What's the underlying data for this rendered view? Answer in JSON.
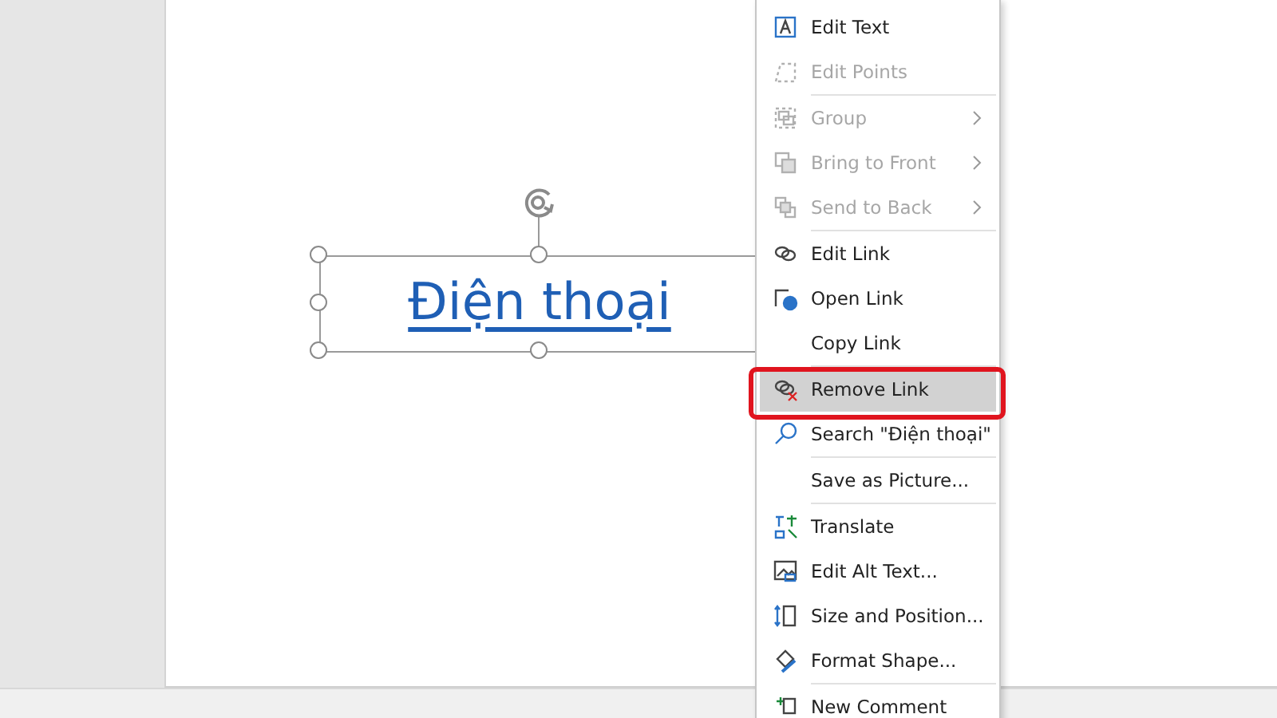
{
  "slide": {
    "text_box": {
      "text": "Điện thoại",
      "selected": true
    }
  },
  "context_menu": {
    "items": [
      {
        "label": "Edit Text",
        "disabled": false,
        "selected": false,
        "submenu": false,
        "separator_after": false
      },
      {
        "label": "Edit Points",
        "disabled": true,
        "selected": false,
        "submenu": false,
        "separator_after": true
      },
      {
        "label": "Group",
        "disabled": true,
        "selected": false,
        "submenu": true,
        "separator_after": false
      },
      {
        "label": "Bring to Front",
        "disabled": true,
        "selected": false,
        "submenu": true,
        "separator_after": false
      },
      {
        "label": "Send to Back",
        "disabled": true,
        "selected": false,
        "submenu": true,
        "separator_after": true
      },
      {
        "label": "Edit Link",
        "disabled": false,
        "selected": false,
        "submenu": false,
        "separator_after": false
      },
      {
        "label": "Open Link",
        "disabled": false,
        "selected": false,
        "submenu": false,
        "separator_after": false
      },
      {
        "label": "Copy Link",
        "disabled": false,
        "selected": false,
        "submenu": false,
        "separator_after": true
      },
      {
        "label": "Remove Link",
        "disabled": false,
        "selected": true,
        "submenu": false,
        "separator_after": false
      },
      {
        "label": "Search \"Điện thoại\"",
        "disabled": false,
        "selected": false,
        "submenu": false,
        "separator_after": true
      },
      {
        "label": "Save as Picture...",
        "disabled": false,
        "selected": false,
        "submenu": false,
        "separator_after": true
      },
      {
        "label": "Translate",
        "disabled": false,
        "selected": false,
        "submenu": false,
        "separator_after": false
      },
      {
        "label": "Edit Alt Text...",
        "disabled": false,
        "selected": false,
        "submenu": false,
        "separator_after": false
      },
      {
        "label": "Size and Position...",
        "disabled": false,
        "selected": false,
        "submenu": false,
        "separator_after": false
      },
      {
        "label": "Format Shape...",
        "disabled": false,
        "selected": false,
        "submenu": false,
        "separator_after": true
      },
      {
        "label": "New Comment",
        "disabled": false,
        "selected": false,
        "submenu": false,
        "separator_after": false
      }
    ]
  }
}
